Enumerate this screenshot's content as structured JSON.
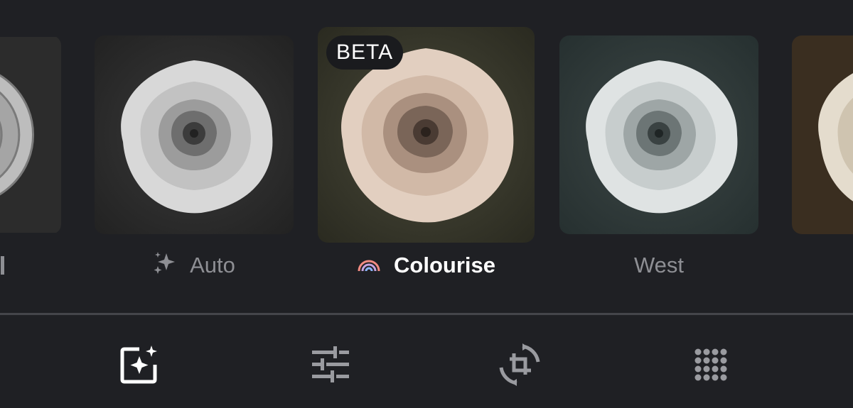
{
  "filters": [
    {
      "id": "partial-left",
      "label": "",
      "tint": "mono-dark",
      "selected": false
    },
    {
      "id": "auto",
      "label": "Auto",
      "icon": "sparkle-icon",
      "tint": "mono",
      "selected": false
    },
    {
      "id": "colourise",
      "label": "Colourise",
      "icon": "rainbow-icon",
      "badge": "BETA",
      "tint": "colour",
      "selected": true
    },
    {
      "id": "west",
      "label": "West",
      "tint": "cool",
      "selected": false
    },
    {
      "id": "partial-right",
      "label": "",
      "tint": "sepia",
      "selected": false
    }
  ],
  "labels": {
    "auto": "Auto",
    "colourise": "Colourise",
    "west": "West",
    "beta": "BETA"
  },
  "toolbar": {
    "tools": [
      {
        "id": "suggestions",
        "icon": "auto-enhance-icon",
        "active": true
      },
      {
        "id": "adjust",
        "icon": "sliders-icon",
        "active": false
      },
      {
        "id": "crop",
        "icon": "crop-rotate-icon",
        "active": false
      },
      {
        "id": "more",
        "icon": "grid-dots-icon",
        "active": false
      }
    ]
  },
  "colors": {
    "background": "#1f2024",
    "divider": "#45464b",
    "active_icon": "#ffffff",
    "inactive_icon": "#9a9ba0",
    "label_inactive": "#8e8f94",
    "label_active": "#ffffff"
  }
}
